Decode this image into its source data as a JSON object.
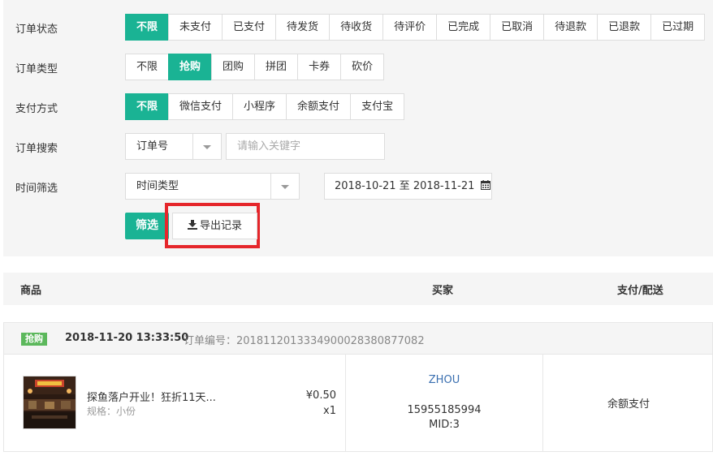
{
  "filters": {
    "status": {
      "label": "订单状态",
      "options": [
        "不限",
        "未支付",
        "已支付",
        "待发货",
        "待收货",
        "待评价",
        "已完成",
        "已取消",
        "待退款",
        "已退款",
        "已过期"
      ],
      "active": 0
    },
    "type": {
      "label": "订单类型",
      "options": [
        "不限",
        "抢购",
        "团购",
        "拼团",
        "卡券",
        "砍价"
      ],
      "active": 1
    },
    "payment": {
      "label": "支付方式",
      "options": [
        "不限",
        "微信支付",
        "小程序",
        "余额支付",
        "支付宝"
      ],
      "active": 0
    },
    "search": {
      "label": "订单搜索",
      "select_value": "订单号",
      "placeholder": "请输入关键字"
    },
    "time": {
      "label": "时间筛选",
      "select_value": "时间类型",
      "date_range": "2018-10-21 至 2018-11-21"
    },
    "filter_button": "筛选",
    "export_button": "导出记录"
  },
  "table": {
    "headers": [
      "商品",
      "买家",
      "支付/配送"
    ]
  },
  "order": {
    "tag": "抢购",
    "time": "2018-11-20 13:33:50",
    "order_no_label": "订单编号：20181120133349000283808770​82",
    "product_name": "探鱼落户开业！狂折11天...",
    "product_spec": "规格：小份",
    "price": "¥0.50",
    "qty": "x1",
    "buyer_name": "ZHOU",
    "buyer_phone": "15955185994",
    "buyer_mid": "MID:3",
    "payment_method": "余额支付"
  },
  "colors": {
    "accent": "#1ab394",
    "tag": "#5cb85c",
    "highlight": "#e5262b",
    "link": "#3a6fb0"
  }
}
